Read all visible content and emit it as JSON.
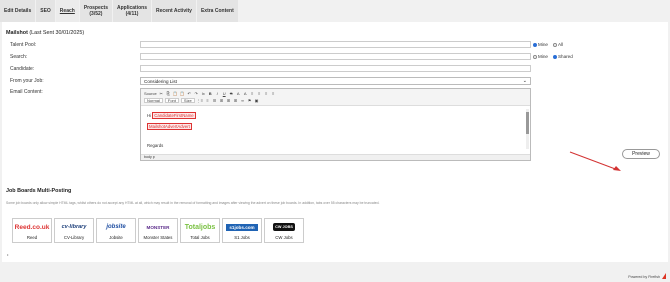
{
  "tabs": [
    {
      "label": "Edit Details",
      "line2": ""
    },
    {
      "label": "SEO",
      "line2": ""
    },
    {
      "label": "Reach",
      "line2": ""
    },
    {
      "label": "Prospects",
      "line2": "(3/52)"
    },
    {
      "label": "Applications",
      "line2": "(4/11)"
    },
    {
      "label": "Recent Activity",
      "line2": ""
    },
    {
      "label": "Extra Content",
      "line2": ""
    }
  ],
  "mailshot": {
    "title": "Mailshot",
    "last_sent": "(Last Sent 30/01/2025)",
    "talent_pool_label": "Talent Pool:",
    "search_label": "Search:",
    "candidate_label": "Candidate:",
    "from_job_label": "From your Job:",
    "email_content_label": "Email Content:",
    "from_job_value": "Considering List",
    "talent_pool_options": [
      "Mine",
      "All"
    ],
    "search_options": [
      "Mine",
      "Shared"
    ]
  },
  "editor": {
    "toolbar_row1": [
      "Source",
      "✂",
      "⎘",
      "📋",
      "📋",
      "↶",
      "↷",
      "Ix",
      "B",
      "I",
      "U",
      "S",
      "A",
      "A",
      "≡",
      "≡",
      "≡",
      "≡"
    ],
    "toolbar_row2_boxes": [
      "Normal",
      "Font",
      "Size"
    ],
    "toolbar_row2_icons": [
      "⋮≡",
      "≡",
      "☰",
      "⊞",
      "⊞",
      "⊞",
      "∞",
      "⚑",
      "▣"
    ],
    "greeting": "Hi",
    "tag_firstname": "CandidateFirstName",
    "tag_ad": "MailshotAdvertAdvert",
    "signoff": "Regards",
    "status": "body  p"
  },
  "preview_label": "Preview",
  "job_boards": {
    "title": "Job Boards Multi-Posting",
    "note": "Some job boards only allow simple HTML tags, whilst others do not accept any HTML at all, which may result in the removal of formatting and images after viewing the advert on these job boards. In addition, tabs over 55 characters may be truncated.",
    "boards": [
      {
        "name": "Reed",
        "logo": "Reed.co.uk"
      },
      {
        "name": "CV-Library",
        "logo": "cv-library"
      },
      {
        "name": "Jobsite",
        "logo": "jobsite"
      },
      {
        "name": "Monster States",
        "logo": "MONSTER"
      },
      {
        "name": "Total Jobs",
        "logo": "Totaljobs"
      },
      {
        "name": "S1 Jobs",
        "logo": "s1jobs.com"
      },
      {
        "name": "CW Jobs",
        "logo": "CW JOBS"
      }
    ],
    "bullet": "•"
  },
  "footer": {
    "powered": "Powered by Firefish"
  },
  "colors": {
    "accent_red": "#d33333",
    "selected_radio": "#2a6fd6"
  }
}
